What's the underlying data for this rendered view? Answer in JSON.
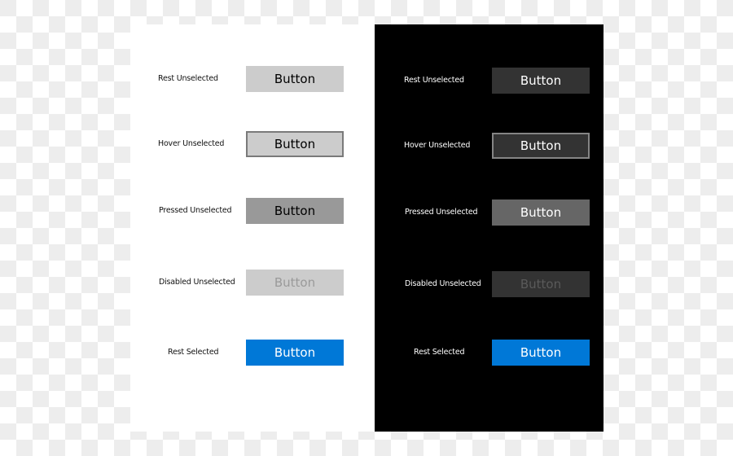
{
  "light_theme": {
    "rows": [
      {
        "label": "Rest Unselected",
        "button": "Button",
        "state": "rest"
      },
      {
        "label": "Hover Unselected",
        "button": "Button",
        "state": "hover"
      },
      {
        "label": "Pressed Unselected",
        "button": "Button",
        "state": "pressed"
      },
      {
        "label": "Disabled Unselected",
        "button": "Button",
        "state": "disabled"
      },
      {
        "label": "Rest Selected",
        "button": "Button",
        "state": "selected"
      }
    ]
  },
  "dark_theme": {
    "rows": [
      {
        "label": "Rest Unselected",
        "button": "Button",
        "state": "rest"
      },
      {
        "label": "Hover Unselected",
        "button": "Button",
        "state": "hover"
      },
      {
        "label": "Pressed Unselected",
        "button": "Button",
        "state": "pressed"
      },
      {
        "label": "Disabled Unselected",
        "button": "Button",
        "state": "disabled"
      },
      {
        "label": "Rest Selected",
        "button": "Button",
        "state": "selected"
      }
    ]
  },
  "colors": {
    "accent": "#0078d7",
    "light_rest": "#cccccc",
    "light_pressed": "#999999",
    "light_hover_border": "#7a7a7a",
    "dark_rest": "#333333",
    "dark_pressed": "#666666",
    "dark_hover_border": "#858585"
  }
}
